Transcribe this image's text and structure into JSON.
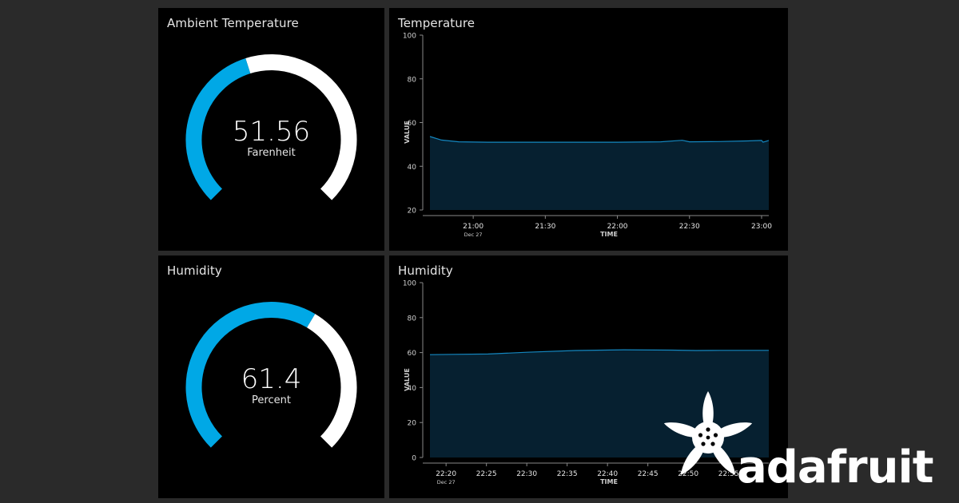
{
  "colors": {
    "accent": "#00a8e6",
    "track": "#ffffff",
    "area": "#062030",
    "panel": "#000000",
    "background": "#2a2a2a"
  },
  "gauge_temperature": {
    "title": "Ambient Temperature",
    "value": "51.56",
    "unit": "Farenheit",
    "fraction": 0.435
  },
  "gauge_humidity": {
    "title": "Humidity",
    "value": "61.4",
    "unit": "Percent",
    "fraction": 0.614
  },
  "chart_temperature": {
    "title": "Temperature"
  },
  "chart_humidity": {
    "title": "Humidity"
  },
  "logo": {
    "text": "adafruit",
    "icon": "flower-logo-icon"
  },
  "chart_data": [
    {
      "type": "area",
      "title": "Temperature",
      "xlabel": "TIME",
      "ylabel": "VALUE",
      "ylim": [
        20,
        100
      ],
      "yticks": [
        20,
        40,
        60,
        80,
        100
      ],
      "xticks": [
        "21:00",
        "21:30",
        "22:00",
        "22:30",
        "23:00"
      ],
      "xsublabel": "Dec 27",
      "xlim": [
        20.7,
        23.05
      ],
      "x": [
        20.7,
        20.78,
        20.9,
        21.1,
        21.5,
        22.0,
        22.3,
        22.45,
        22.5,
        22.7,
        22.9,
        23.0,
        23.01,
        23.05
      ],
      "values": [
        53.6,
        52.0,
        51.2,
        51.0,
        51.0,
        51.0,
        51.2,
        51.9,
        51.2,
        51.3,
        51.6,
        51.8,
        51.0,
        51.8
      ],
      "grid": false
    },
    {
      "type": "area",
      "title": "Humidity",
      "xlabel": "TIME",
      "ylabel": "VALUE",
      "ylim": [
        0,
        100
      ],
      "yticks": [
        0,
        20,
        40,
        60,
        80,
        100
      ],
      "xticks": [
        "22:20",
        "22:25",
        "22:30",
        "22:35",
        "22:40",
        "22:45",
        "22:50",
        "22:55"
      ],
      "xsublabel": "Dec 27",
      "xlim": [
        22.3,
        23.0
      ],
      "x": [
        22.3,
        22.35,
        22.42,
        22.5,
        22.6,
        22.7,
        22.8,
        22.85,
        22.9,
        23.0
      ],
      "values": [
        58.8,
        59.0,
        59.2,
        60.2,
        61.2,
        61.6,
        61.4,
        61.2,
        61.3,
        61.3
      ],
      "grid": false
    }
  ]
}
